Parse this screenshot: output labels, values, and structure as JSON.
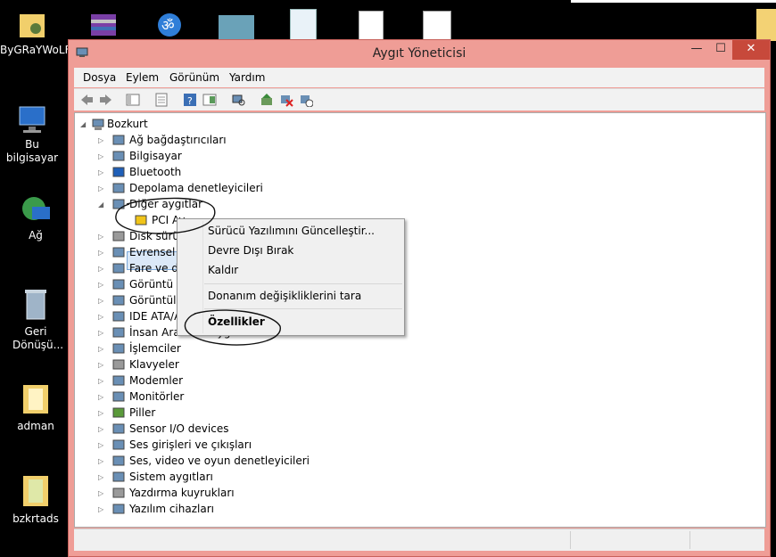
{
  "desktop": {
    "icons": [
      {
        "label": "ByGRaYWoLF",
        "icon": "user-folder-icon"
      },
      {
        "label": "Bu bilgisayar",
        "icon": "computer-icon"
      },
      {
        "label": "Ağ",
        "icon": "network-icon"
      },
      {
        "label": "Geri Dönüşü...",
        "icon": "recycle-bin-icon"
      },
      {
        "label": "adman",
        "icon": "folder-icon"
      },
      {
        "label": "bzkrtads",
        "icon": "folder-icon"
      }
    ]
  },
  "window": {
    "title": "Aygıt Yöneticisi",
    "controls": {
      "minimize": "—",
      "maximize": "☐",
      "close": "✕"
    },
    "menu": [
      "Dosya",
      "Eylem",
      "Görünüm",
      "Yardım"
    ]
  },
  "tree": {
    "root": "Bozkurt",
    "items": [
      {
        "label": "Ağ bağdaştırıcıları",
        "icon": "network-adapter-icon"
      },
      {
        "label": "Bilgisayar",
        "icon": "computer-icon"
      },
      {
        "label": "Bluetooth",
        "icon": "bluetooth-icon"
      },
      {
        "label": "Depolama denetleyicileri",
        "icon": "storage-controller-icon"
      },
      {
        "label": "Diğer aygıtlar",
        "icon": "other-devices-icon",
        "expanded": true
      },
      {
        "label": "PCI Ay",
        "icon": "warning-device-icon",
        "child": true,
        "selected": true
      },
      {
        "label": "Disk sürü",
        "icon": "disk-icon"
      },
      {
        "label": "Evrensel S",
        "icon": "usb-icon"
      },
      {
        "label": "Fare ve di",
        "icon": "mouse-icon"
      },
      {
        "label": "Görüntü b",
        "icon": "display-icon"
      },
      {
        "label": "Görüntüle",
        "icon": "imaging-icon"
      },
      {
        "label": "IDE ATA/A",
        "icon": "ide-icon"
      },
      {
        "label": "İnsan Arabirim Aygıtları",
        "icon": "hid-icon"
      },
      {
        "label": "İşlemciler",
        "icon": "processor-icon"
      },
      {
        "label": "Klavyeler",
        "icon": "keyboard-icon"
      },
      {
        "label": "Modemler",
        "icon": "modem-icon"
      },
      {
        "label": "Monitörler",
        "icon": "monitor-icon"
      },
      {
        "label": "Piller",
        "icon": "battery-icon"
      },
      {
        "label": "Sensor I/O devices",
        "icon": "sensor-icon"
      },
      {
        "label": "Ses girişleri ve çıkışları",
        "icon": "audio-icon"
      },
      {
        "label": "Ses, video ve oyun denetleyicileri",
        "icon": "audio-icon"
      },
      {
        "label": "Sistem aygıtları",
        "icon": "system-icon"
      },
      {
        "label": "Yazdırma kuyrukları",
        "icon": "printer-icon"
      },
      {
        "label": "Yazılım cihazları",
        "icon": "software-device-icon"
      }
    ]
  },
  "context_menu": {
    "items": [
      {
        "label": "Sürücü Yazılımını Güncelleştir...",
        "bold": false
      },
      {
        "label": "Devre Dışı Bırak",
        "bold": false
      },
      {
        "label": "Kaldır",
        "bold": false
      },
      {
        "label": "Donanım değişikliklerini tara",
        "bold": false
      },
      {
        "label": "Özellikler",
        "bold": true
      }
    ]
  },
  "colors": {
    "window_frame": "#ef9d96",
    "close_button": "#c7493b",
    "selection": "#dbe8f7",
    "desktop": "#000000"
  }
}
